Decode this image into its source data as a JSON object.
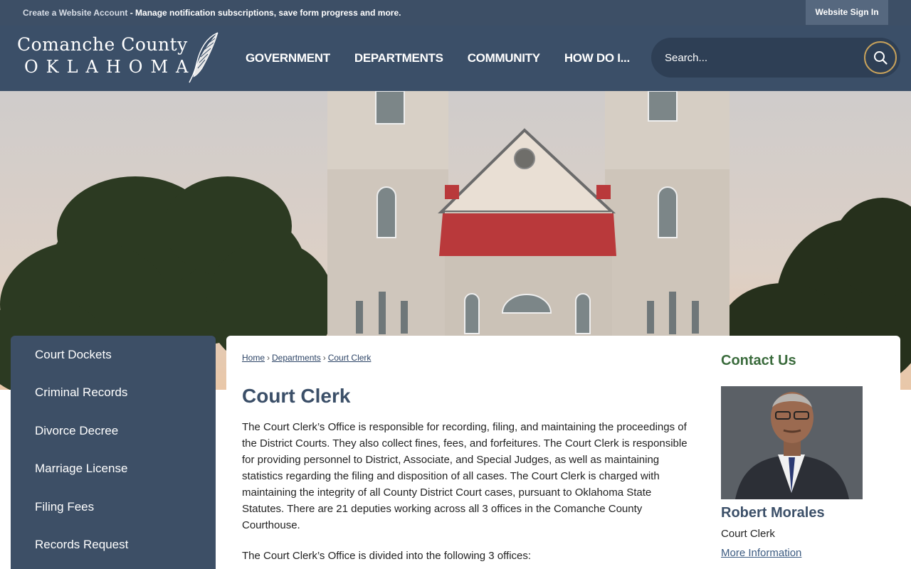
{
  "topbar": {
    "account_link": "Create a Website Account",
    "account_text": " - Manage notification subscriptions, save form progress and more.",
    "signin": "Website Sign In"
  },
  "logo": {
    "line1": "Comanche County",
    "line2": "OKLAHOMA"
  },
  "nav": [
    "GOVERNMENT",
    "DEPARTMENTS",
    "COMMUNITY",
    "HOW DO I..."
  ],
  "search": {
    "placeholder": "Search..."
  },
  "sidebar": {
    "items": [
      {
        "label": "Court Dockets"
      },
      {
        "label": "Criminal Records"
      },
      {
        "label": "Divorce Decree"
      },
      {
        "label": "Marriage License"
      },
      {
        "label": "Filing Fees"
      },
      {
        "label": "Records Request"
      }
    ]
  },
  "breadcrumb": {
    "home": "Home",
    "departments": "Departments",
    "current": "Court Clerk"
  },
  "main": {
    "title": "Court Clerk",
    "para1": "The Court Clerk’s Office is responsible for recording, filing, and maintaining the proceedings of the District Courts. They also collect fines, fees, and forfeitures. The Court Clerk is responsible for providing personnel to District, Associate, and Special Judges, as well as maintaining statistics regarding the filing and disposition of all cases. The Court Clerk is charged with maintaining the integrity of all County District Court cases, pursuant to Oklahoma State Statutes. There are 21 deputies working across all 3 offices in the Comanche County Courthouse.",
    "para2": "The Court Clerk’s Office is divided into the following 3 offices:"
  },
  "contact": {
    "heading": "Contact Us",
    "name": "Robert Morales",
    "role": "Court Clerk",
    "more": "More Information"
  }
}
